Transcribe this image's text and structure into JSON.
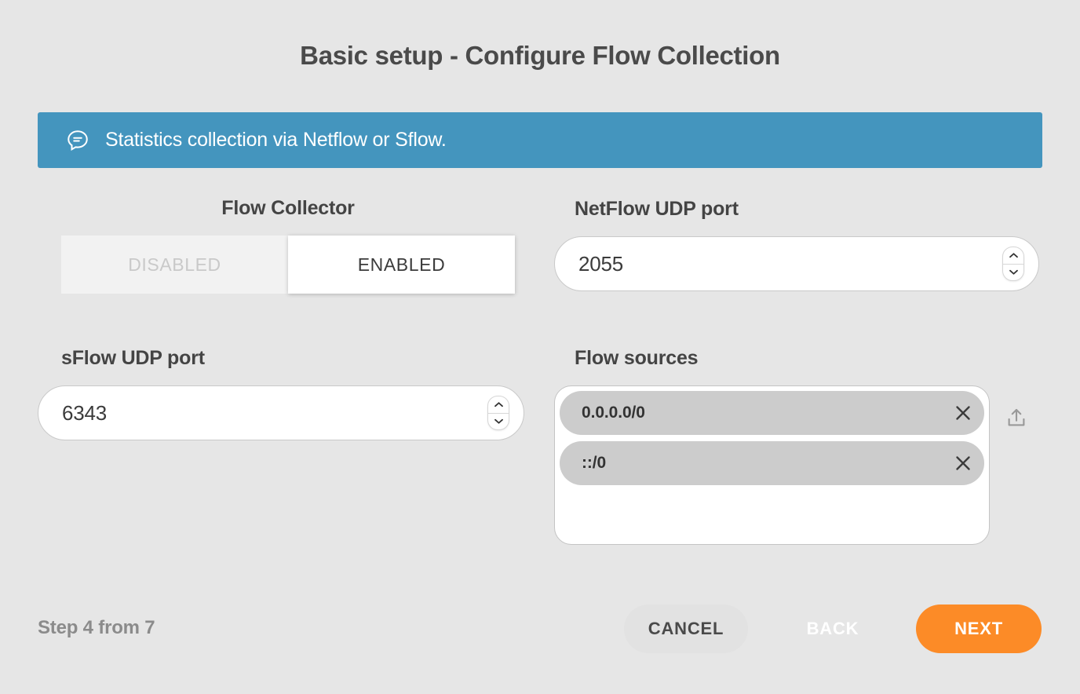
{
  "page": {
    "title": "Basic setup - Configure Flow Collection",
    "background_color": "#e6e6e6"
  },
  "banner": {
    "text": "Statistics collection via Netflow or Sflow.",
    "icon": "comment-bubble-icon",
    "background_color": "#4495be",
    "text_color": "#ffffff"
  },
  "flow_collector": {
    "label": "Flow Collector",
    "options": [
      "DISABLED",
      "ENABLED"
    ],
    "disabled_label": "DISABLED",
    "enabled_label": "ENABLED",
    "selected": "ENABLED"
  },
  "netflow_port": {
    "label": "NetFlow UDP port",
    "value": "2055",
    "stepper_up_icon": "chevron-up-icon",
    "stepper_down_icon": "chevron-down-icon"
  },
  "sflow_port": {
    "label": "sFlow UDP port",
    "value": "6343",
    "stepper_up_icon": "chevron-up-icon",
    "stepper_down_icon": "chevron-down-icon"
  },
  "flow_sources": {
    "label": "Flow sources",
    "chips": [
      {
        "value": "0.0.0.0/0",
        "remove_icon": "close-icon"
      },
      {
        "value": "::/0",
        "remove_icon": "close-icon"
      }
    ],
    "upload_icon": "upload-icon",
    "chip_color": "#cccccc"
  },
  "footer": {
    "step_text": "Step 4 from 7",
    "cancel_label": "CANCEL",
    "back_label": "BACK",
    "next_label": "NEXT",
    "next_color": "#fc8b27"
  }
}
